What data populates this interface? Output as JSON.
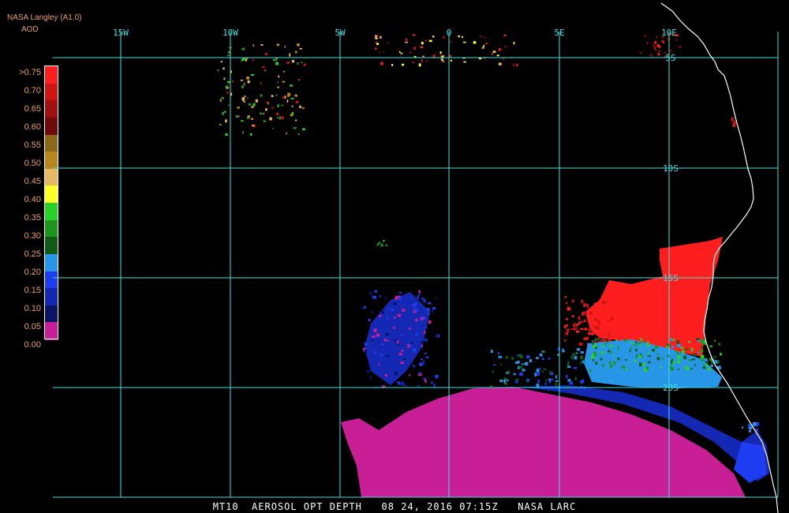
{
  "header": {
    "source": "NASA Langley (A1.0)",
    "product": "AOD"
  },
  "legend": {
    "items": [
      {
        "label": ">0.75",
        "color": "#ff1e1e"
      },
      {
        "label": "0.70",
        "color": "#d01414"
      },
      {
        "label": "0.65",
        "color": "#a01010"
      },
      {
        "label": "0.60",
        "color": "#6e0a0a"
      },
      {
        "label": "0.55",
        "color": "#8a6a1a"
      },
      {
        "label": "0.50",
        "color": "#b8861e"
      },
      {
        "label": "0.45",
        "color": "#e6b864"
      },
      {
        "label": "0.40",
        "color": "#ffff28"
      },
      {
        "label": "0.35",
        "color": "#28d228"
      },
      {
        "label": "0.30",
        "color": "#1e961e"
      },
      {
        "label": "0.25",
        "color": "#0f5a14"
      },
      {
        "label": "0.20",
        "color": "#2896e6"
      },
      {
        "label": "0.15",
        "color": "#1e3cf0"
      },
      {
        "label": "0.10",
        "color": "#1428b4"
      },
      {
        "label": "0.05",
        "color": "#0a1464"
      },
      {
        "label": "0.00",
        "color": "#c81e96"
      }
    ]
  },
  "map": {
    "longitude_labels": [
      "15W",
      "10W",
      "5W",
      "0",
      "5E",
      "10E"
    ],
    "latitude_labels": [
      "5S",
      "10S",
      "15S",
      "20S"
    ],
    "colors": {
      "grid": "#40e0e0",
      "coast": "#ffffff",
      "labels": "#e8a060",
      "lon_labels": "#40e0e0"
    }
  },
  "footer": {
    "caption": "MT10  AEROSOL OPT DEPTH   08 24, 2016 07:15Z   NASA LARC"
  }
}
